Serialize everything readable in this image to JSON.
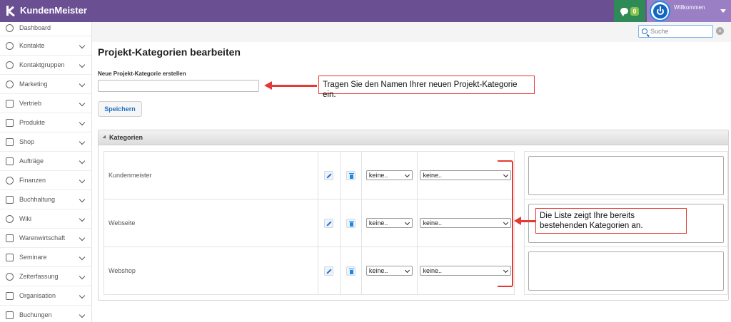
{
  "app": {
    "title": "KundenMeister"
  },
  "header": {
    "chat_count": "0",
    "welcome": "Willkommen"
  },
  "search": {
    "placeholder": "Suche",
    "value": ""
  },
  "sidebar": {
    "items": [
      {
        "label": "Dashboard",
        "icon": "dashboard-icon"
      },
      {
        "label": "Kontakte",
        "icon": "contacts-icon"
      },
      {
        "label": "Kontaktgruppen",
        "icon": "groups-icon"
      },
      {
        "label": "Marketing",
        "icon": "marketing-icon"
      },
      {
        "label": "Vertrieb",
        "icon": "chart-icon"
      },
      {
        "label": "Produkte",
        "icon": "box-icon"
      },
      {
        "label": "Shop",
        "icon": "tag-icon"
      },
      {
        "label": "Aufträge",
        "icon": "orders-icon"
      },
      {
        "label": "Finanzen",
        "icon": "money-icon"
      },
      {
        "label": "Buchhaltung",
        "icon": "ledger-icon"
      },
      {
        "label": "Wiki",
        "icon": "bulb-icon"
      },
      {
        "label": "Warenwirtschaft",
        "icon": "cart-icon"
      },
      {
        "label": "Seminare",
        "icon": "graduation-icon"
      },
      {
        "label": "Zeiterfassung",
        "icon": "clock-icon"
      },
      {
        "label": "Organisation",
        "icon": "clipboard-icon"
      },
      {
        "label": "Buchungen",
        "icon": "calendar-icon"
      }
    ]
  },
  "page": {
    "title": "Projekt-Kategorien bearbeiten",
    "new_label": "Neue Projekt-Kategorie erstellen",
    "new_value": "",
    "save_label": "Speichern"
  },
  "panel": {
    "title": "Kategorien",
    "rows": [
      {
        "name": "Kundenmeister",
        "select1": "keine..",
        "select2": "keine.."
      },
      {
        "name": "Webseite",
        "select1": "keine..",
        "select2": "keine.."
      },
      {
        "name": "Webshop",
        "select1": "keine..",
        "select2": "keine.."
      }
    ]
  },
  "annotations": {
    "input_hint": "Tragen Sie den Namen Ihrer neuen Projekt-Kategorie ein.",
    "list_hint": "Die Liste zeigt Ihre bereits bestehenden Kategorien an."
  },
  "colors": {
    "brand": "#6a4f93",
    "chat": "#2e8b57",
    "user": "#9b7fc5",
    "annotation": "#e53935",
    "link": "#1e6fc0"
  }
}
